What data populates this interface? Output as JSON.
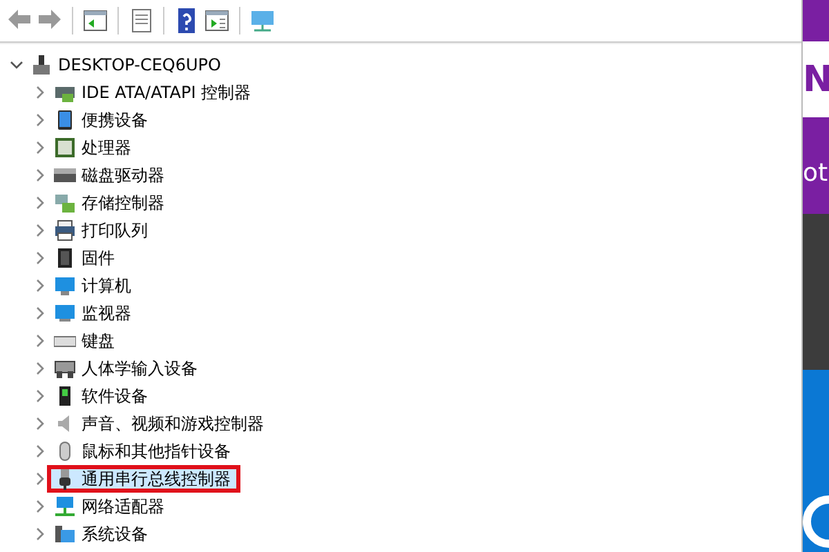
{
  "toolbar": {
    "buttons": [
      {
        "kind": "back",
        "disabled": true
      },
      {
        "kind": "forward",
        "disabled": true
      },
      {
        "kind": "separator"
      },
      {
        "kind": "console"
      },
      {
        "kind": "separator"
      },
      {
        "kind": "properties"
      },
      {
        "kind": "separator"
      },
      {
        "kind": "help"
      },
      {
        "kind": "pane"
      },
      {
        "kind": "separator"
      },
      {
        "kind": "monitor"
      }
    ]
  },
  "tree": {
    "label": "DESKTOP-CEQ6UPO",
    "expanded": true,
    "children": [
      {
        "label": "IDE ATA/ATAPI 控制器",
        "expanded": false,
        "selected": false
      },
      {
        "label": "便携设备",
        "expanded": false,
        "selected": false
      },
      {
        "label": "处理器",
        "expanded": false,
        "selected": false
      },
      {
        "label": "磁盘驱动器",
        "expanded": false,
        "selected": false
      },
      {
        "label": "存储控制器",
        "expanded": false,
        "selected": false
      },
      {
        "label": "打印队列",
        "expanded": false,
        "selected": false
      },
      {
        "label": "固件",
        "expanded": false,
        "selected": false
      },
      {
        "label": "计算机",
        "expanded": false,
        "selected": false
      },
      {
        "label": "监视器",
        "expanded": false,
        "selected": false
      },
      {
        "label": "键盘",
        "expanded": false,
        "selected": false
      },
      {
        "label": "人体学输入设备",
        "expanded": false,
        "selected": false
      },
      {
        "label": "软件设备",
        "expanded": false,
        "selected": false
      },
      {
        "label": "声音、视频和游戏控制器",
        "expanded": false,
        "selected": false
      },
      {
        "label": "鼠标和其他指针设备",
        "expanded": false,
        "selected": false
      },
      {
        "label": "通用串行总线控制器",
        "expanded": false,
        "selected": true,
        "marked": true
      },
      {
        "label": "网络适配器",
        "expanded": false,
        "selected": false
      },
      {
        "label": "系统设备",
        "expanded": false,
        "selected": false
      }
    ]
  },
  "side_strip": {
    "tile_letter": "N",
    "text": "ot"
  }
}
